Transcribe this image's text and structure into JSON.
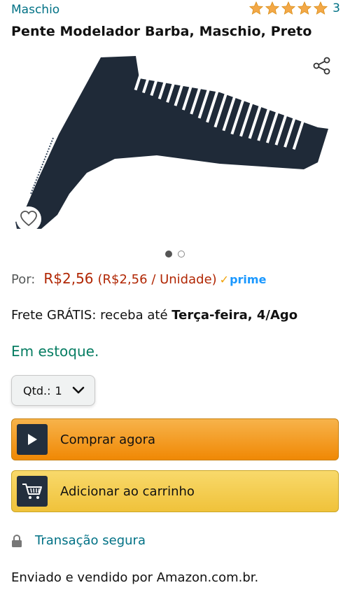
{
  "brand": "Maschio",
  "rating": {
    "stars": 5,
    "count": "3"
  },
  "title": "Pente Modelador Barba, Maschio, Preto",
  "icons": {
    "share": "share-icon",
    "wishlist": "heart-icon",
    "buy": "play-icon",
    "cart": "cart-icon",
    "lock": "lock-icon"
  },
  "carousel": {
    "total": 2,
    "active": 1
  },
  "price": {
    "label": "Por:",
    "value": "R$2,56",
    "unit": "(R$2,56 / Unidade)",
    "prime_check": "✓",
    "prime": "prime"
  },
  "delivery": {
    "prefix": "Frete GRÁTIS: receba até ",
    "date": "Terça-feira, 4/Ago"
  },
  "stock": "Em estoque.",
  "quantity": {
    "label": "Qtd.:",
    "value": "1"
  },
  "buttons": {
    "buy_now": "Comprar agora",
    "add_to_cart": "Adicionar ao carrinho"
  },
  "secure": "Transação segura",
  "sold_by": "Enviado e vendido por Amazon.com.br.",
  "colors": {
    "link": "#007185",
    "price": "#B12704",
    "stock": "#067D62",
    "buy": "#F08804",
    "cart": "#F0C23A",
    "star": "#F3A847",
    "prime": "#1A98FF"
  }
}
